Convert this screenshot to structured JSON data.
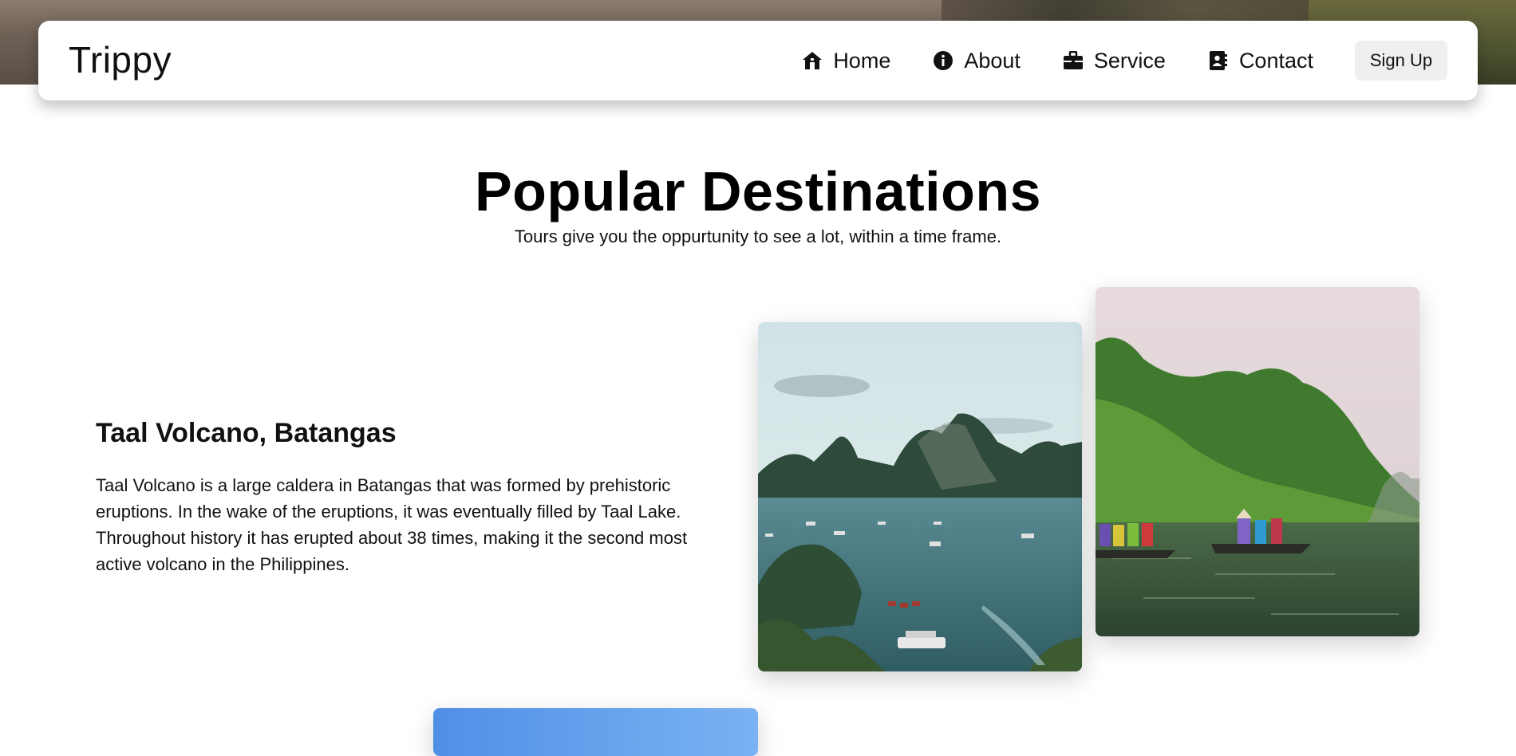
{
  "navbar": {
    "brand": "Trippy",
    "links": [
      {
        "label": "Home",
        "icon": "house-icon"
      },
      {
        "label": "About",
        "icon": "info-circle-icon"
      },
      {
        "label": "Service",
        "icon": "briefcase-icon"
      },
      {
        "label": "Contact",
        "icon": "address-book-icon"
      }
    ],
    "signup_label": "Sign Up"
  },
  "section": {
    "title": "Popular Destinations",
    "subtitle": "Tours give you the oppurtunity to see a lot, within a time frame."
  },
  "destination": {
    "title": "Taal Volcano, Batangas",
    "description": "Taal Volcano is a large caldera in Batangas that was formed by prehistoric eruptions. In the wake of the eruptions, it was eventually filled by Taal Lake. Throughout history it has erupted about 38 times, making it the second most active volcano in the Philippines."
  },
  "colors": {
    "navbar_bg": "#ffffff",
    "signup_bg": "#efefef",
    "text": "#111111"
  }
}
